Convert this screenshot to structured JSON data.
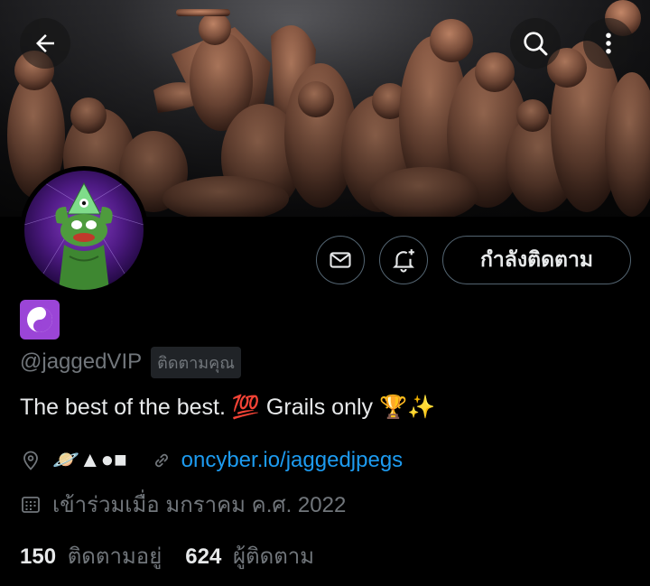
{
  "header": {
    "back_icon": "arrow-left-icon",
    "search_icon": "search-icon",
    "more_icon": "more-vertical-icon"
  },
  "profile": {
    "emoji_badge": "☯️",
    "handle": "@jaggedVIP",
    "follows_you": "ติดตามคุณ",
    "bio": "The best of the best. 💯 Grails only 🏆✨",
    "location": "🪐▲●■",
    "website": "oncyber.io/jaggedjpegs",
    "joined": "เข้าร่วมเมื่อ มกราคม ค.ศ. 2022",
    "following_count": "150",
    "following_label": "ติดตามอยู่",
    "followers_count": "624",
    "followers_label": "ผู้ติดตาม"
  },
  "actions": {
    "message_icon": "mail-icon",
    "notify_icon": "bell-plus-icon",
    "follow_label": "กำลังติดตาม"
  },
  "colors": {
    "background": "#000000",
    "text": "#e7e9ea",
    "muted": "#71767b",
    "link": "#1d9bf0",
    "border": "#536471",
    "badge": "#9b45d7"
  }
}
